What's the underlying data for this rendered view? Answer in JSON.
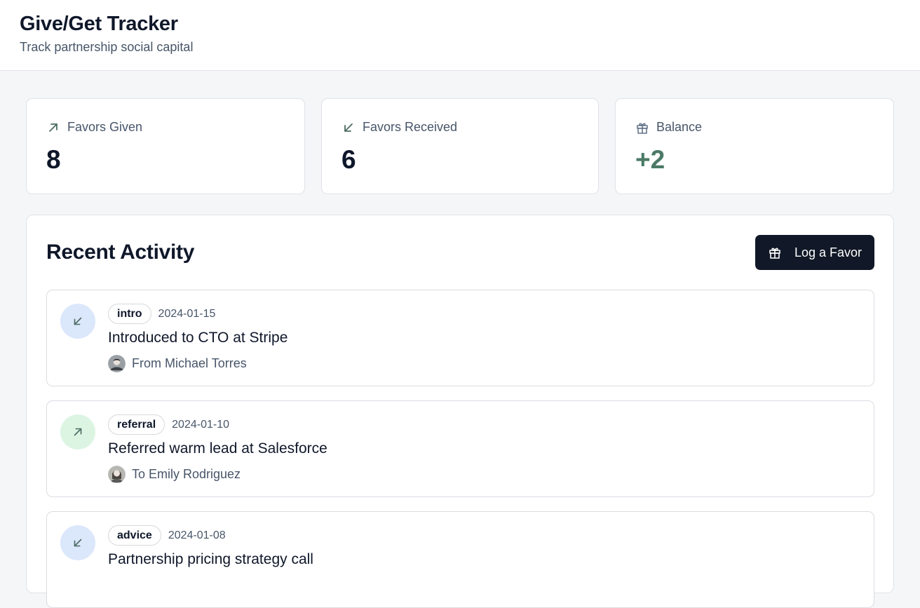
{
  "header": {
    "title": "Give/Get Tracker",
    "subtitle": "Track partnership social capital"
  },
  "stats": [
    {
      "label": "Favors Given",
      "value": "8",
      "icon": "arrow-up-right-icon"
    },
    {
      "label": "Favors Received",
      "value": "6",
      "icon": "arrow-down-left-icon"
    },
    {
      "label": "Balance",
      "value": "+2",
      "icon": "gift-icon",
      "color": "#4b7a66"
    }
  ],
  "activity": {
    "title": "Recent Activity",
    "log_button_label": "Log a Favor",
    "log_button_icon": "gift-icon",
    "items": [
      {
        "direction": "received",
        "tag": "intro",
        "date": "2024-01-15",
        "title": "Introduced to CTO at Stripe",
        "person": "From Michael Torres"
      },
      {
        "direction": "given",
        "tag": "referral",
        "date": "2024-01-10",
        "title": "Referred warm lead at Salesforce",
        "person": "To Emily Rodriguez"
      },
      {
        "direction": "received",
        "tag": "advice",
        "date": "2024-01-08",
        "title": "Partnership pricing strategy call",
        "person": ""
      }
    ]
  },
  "colors": {
    "received_circle": "#dbe7fb",
    "given_circle": "#dcf5e3",
    "arrow": "#4b6b62",
    "button_bg": "#111827"
  }
}
